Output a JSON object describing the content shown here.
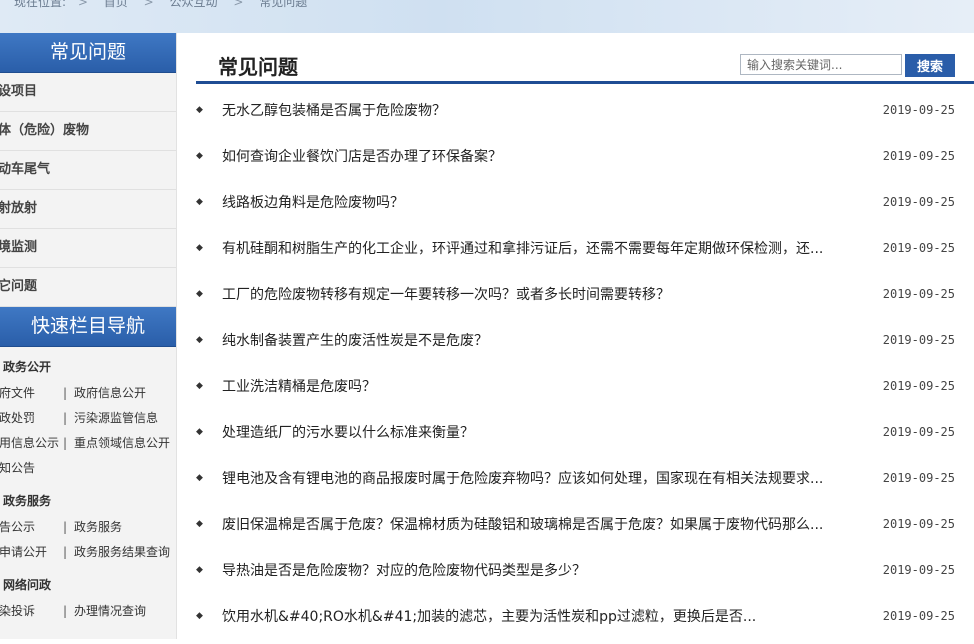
{
  "breadcrumb": {
    "prefix": "现在位置:",
    "items": [
      "首页",
      "公众互动",
      "常见问题"
    ],
    "separator": ">"
  },
  "sidebar": {
    "faq_title": "常见问题",
    "faq_items": [
      {
        "label": "设项目"
      },
      {
        "label": "体（危险）废物"
      },
      {
        "label": "动车尾气"
      },
      {
        "label": "射放射"
      },
      {
        "label": "境监测"
      },
      {
        "label": "它问题"
      }
    ],
    "quicknav_title": "快速栏目导航",
    "groups": [
      {
        "title": "政务公开",
        "rows": [
          {
            "left": "府文件",
            "right": "政府信息公开"
          },
          {
            "left": "政处罚",
            "right": "污染源监管信息"
          },
          {
            "left": "用信息公示",
            "right": "重点领域信息公开"
          },
          {
            "left": "知公告",
            "right": ""
          }
        ]
      },
      {
        "title": "政务服务",
        "rows": [
          {
            "left": "告公示",
            "right": "政务服务"
          },
          {
            "left": "申请公开",
            "right": "政务服务结果查询"
          }
        ]
      },
      {
        "title": "网络问政",
        "rows": [
          {
            "left": "染投诉",
            "right": "办理情况查询"
          }
        ]
      }
    ],
    "bar_char": "|"
  },
  "main": {
    "title": "常见问题",
    "search": {
      "placeholder": "输入搜索关键词...",
      "button_label": "搜索"
    },
    "bullet_char": "◆",
    "items": [
      {
        "question": "无水乙醇包装桶是否属于危险废物？",
        "date": "2019-09-25"
      },
      {
        "question": "如何查询企业餐饮门店是否办理了环保备案？",
        "date": "2019-09-25"
      },
      {
        "question": "线路板边角料是危险废物吗？",
        "date": "2019-09-25"
      },
      {
        "question": "有机硅酮和树脂生产的化工企业，环评通过和拿排污证后，还需不需要每年定期做环保检测，还...",
        "date": "2019-09-25"
      },
      {
        "question": "工厂的危险废物转移有规定一年要转移一次吗？或者多长时间需要转移？",
        "date": "2019-09-25"
      },
      {
        "question": "纯水制备装置产生的废活性炭是不是危废？",
        "date": "2019-09-25"
      },
      {
        "question": "工业洗洁精桶是危废吗？",
        "date": "2019-09-25"
      },
      {
        "question": "处理造纸厂的污水要以什么标准来衡量？",
        "date": "2019-09-25"
      },
      {
        "question": "锂电池及含有锂电池的商品报废时属于危险废弃物吗？应该如何处理，国家现在有相关法规要求...",
        "date": "2019-09-25"
      },
      {
        "question": "废旧保温棉是否属于危废？保温棉材质为硅酸铝和玻璃棉是否属于危废？如果属于废物代码那么...",
        "date": "2019-09-25"
      },
      {
        "question": "导热油是否是危险废物？对应的危险废物代码类型是多少？",
        "date": "2019-09-25"
      },
      {
        "question": "饮用水机&#40;RO水机&#41;加装的滤芯，主要为活性炭和pp过滤粒，更换后是否...",
        "date": "2019-09-25"
      }
    ]
  },
  "colors": {
    "accent": "#2a5da9",
    "rule": "#1f4d94",
    "sidebar_bg": "#f3f3f3"
  }
}
